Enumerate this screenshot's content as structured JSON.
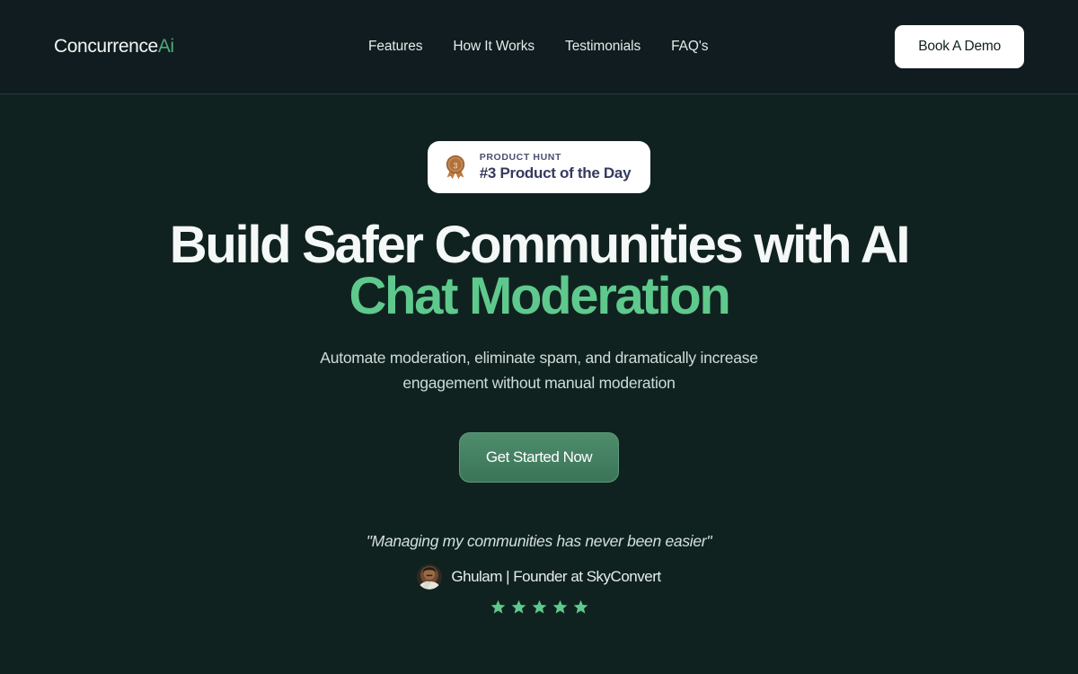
{
  "header": {
    "logo": {
      "name": "Concurrence",
      "accent": "Ai"
    },
    "nav": [
      {
        "label": "Features",
        "name": "features"
      },
      {
        "label": "How It Works",
        "name": "how-it-works"
      },
      {
        "label": "Testimonials",
        "name": "testimonials"
      },
      {
        "label": "FAQ's",
        "name": "faqs"
      }
    ],
    "cta_label": "Book A Demo"
  },
  "hero": {
    "badge": {
      "icon": "medal-icon",
      "medal_number": "3",
      "kicker": "PRODUCT HUNT",
      "title": "#3 Product of the Day"
    },
    "headline_line1": "Build Safer Communities with AI",
    "headline_line2": "Chat Moderation",
    "subtitle": "Automate moderation, eliminate spam, and dramatically increase engagement without manual moderation",
    "cta_label": "Get Started Now",
    "testimonial": {
      "quote": "\"Managing my communities has never been easier\"",
      "author": "Ghulam | Founder at SkyConvert",
      "avatar_icon": "avatar-photo",
      "rating": 5,
      "star_icon": "star-icon"
    }
  },
  "colors": {
    "header_bg": "#101c20",
    "hero_bg": "#102220",
    "accent_green": "#5fc98d",
    "logo_green": "#4fa97a",
    "cta_green": "#3b7458",
    "badge_text": "#353b5e",
    "white": "#ffffff"
  }
}
